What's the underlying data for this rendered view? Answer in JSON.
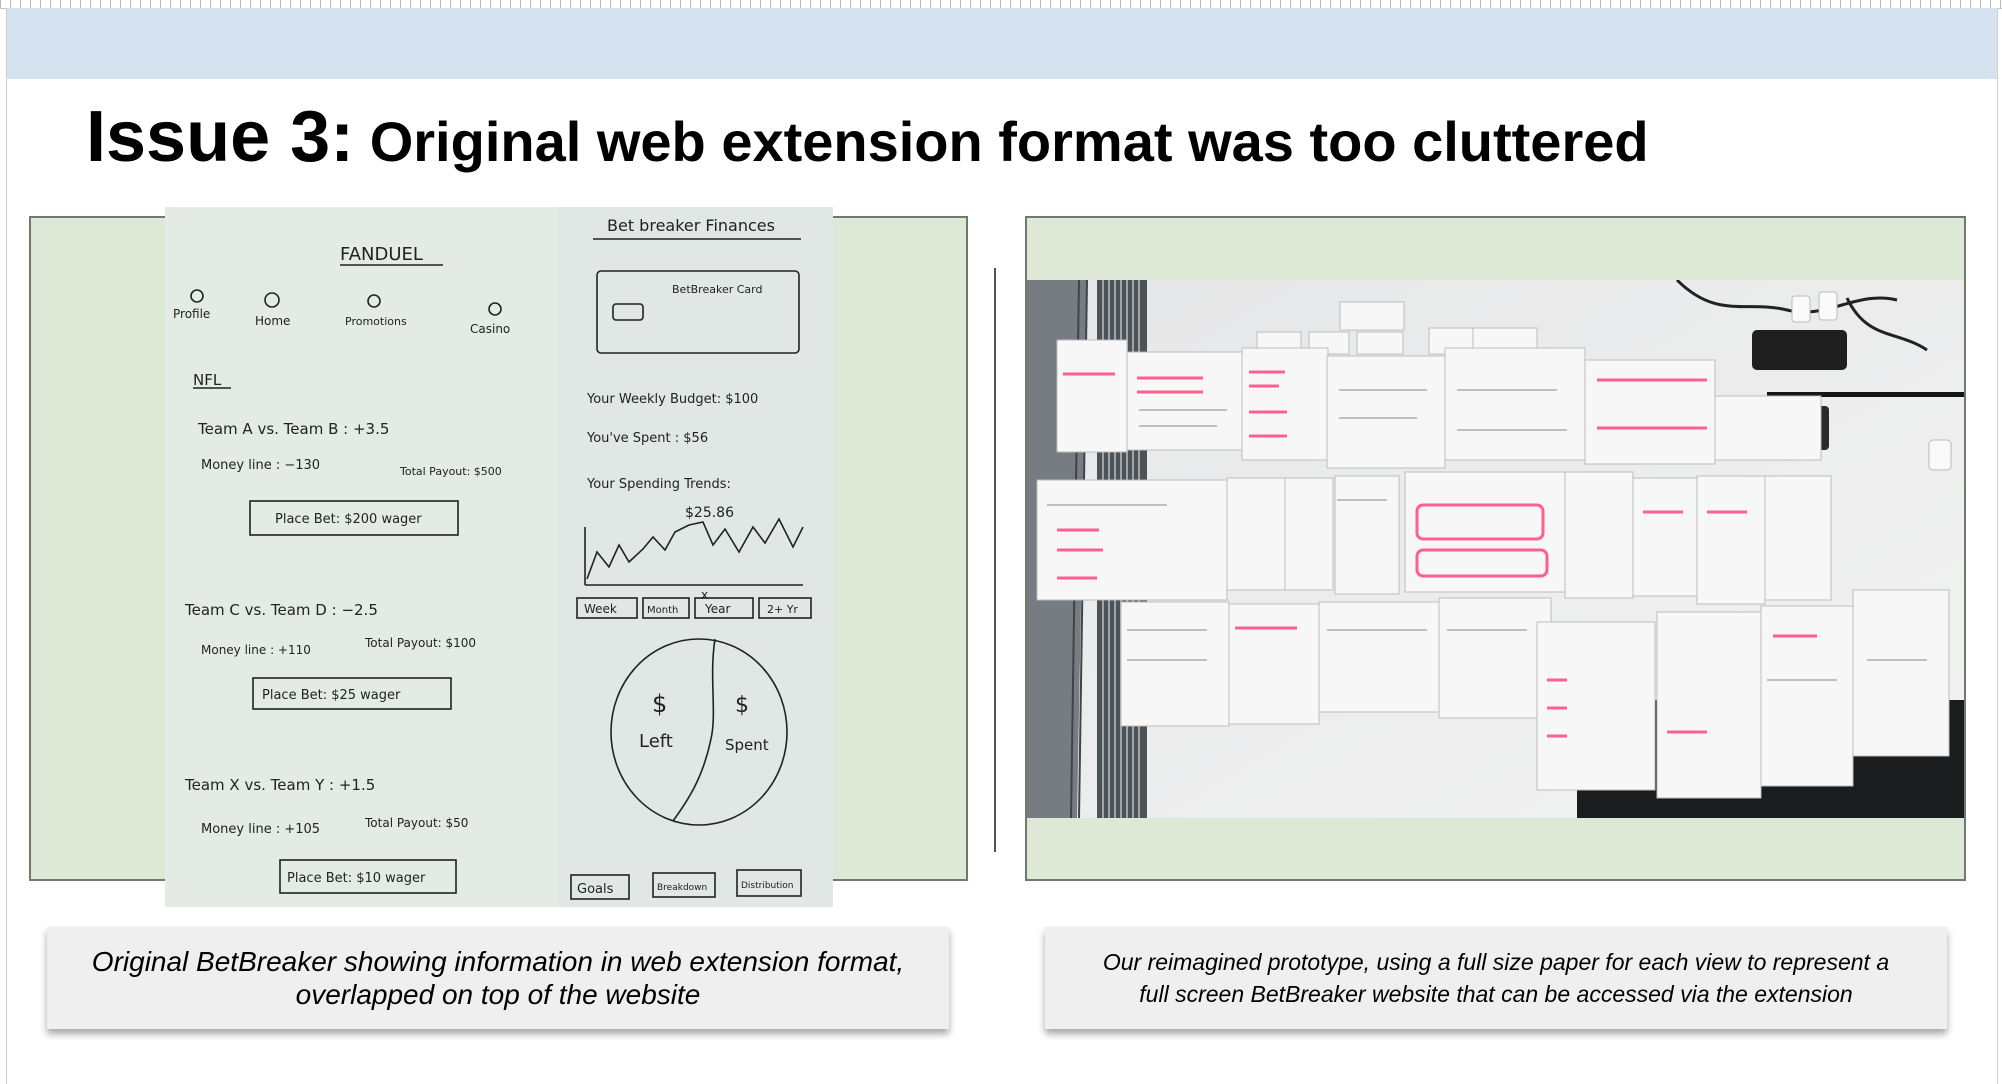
{
  "slide": {
    "title_lead": "Issue 3:",
    "title_rest": " Original web extension format was too cluttered"
  },
  "left_sketch": {
    "fanduel": {
      "title": "FANDUEL",
      "nav": [
        "Profile",
        "Home",
        "Promotions",
        "Casino"
      ],
      "section": "NFL",
      "games": [
        {
          "matchup": "Team  A  vs.  Team  B : +3.5",
          "line": "Money line : −130",
          "payout": "Total Payout: $500",
          "button": "Place Bet: $200 wager"
        },
        {
          "matchup": "Team  C  vs.  Team  D : −2.5",
          "line": "Money line : +110",
          "payout": "Total Payout: $100",
          "button": "Place Bet: $25 wager"
        },
        {
          "matchup": "Team  X  vs.  Team  Y : +1.5",
          "line": "Money line : +105",
          "payout": "Total Payout: $50",
          "button": "Place Bet: $10 wager"
        }
      ]
    },
    "finances": {
      "title": "Bet breaker Finances",
      "card_label": "BetBreaker Card",
      "budget": "Your Weekly Budget: $100",
      "spent": "You've Spent : $56",
      "trends": "Your Spending Trends:",
      "peak": "$25.86",
      "ranges": [
        "Week",
        "Month",
        "Year",
        "2+ Yr"
      ],
      "pie": {
        "left": "Left",
        "spent": "Spent",
        "currency": "$"
      },
      "tabs": [
        "Goals",
        "Breakdown",
        "Distribution"
      ]
    }
  },
  "captions": {
    "left": "Original BetBreaker showing information in web extension format, overlapped on top of the website",
    "right": "Our reimagined prototype, using a full size paper for each view to represent a full screen BetBreaker website that can be accessed via the extension"
  },
  "colors": {
    "header_band": "#d5e2f0",
    "panel_fill": "#dde8d6",
    "caption_fill": "#efefef",
    "sketch_ink": "#222222",
    "highlighter": "#ff5f8f"
  }
}
